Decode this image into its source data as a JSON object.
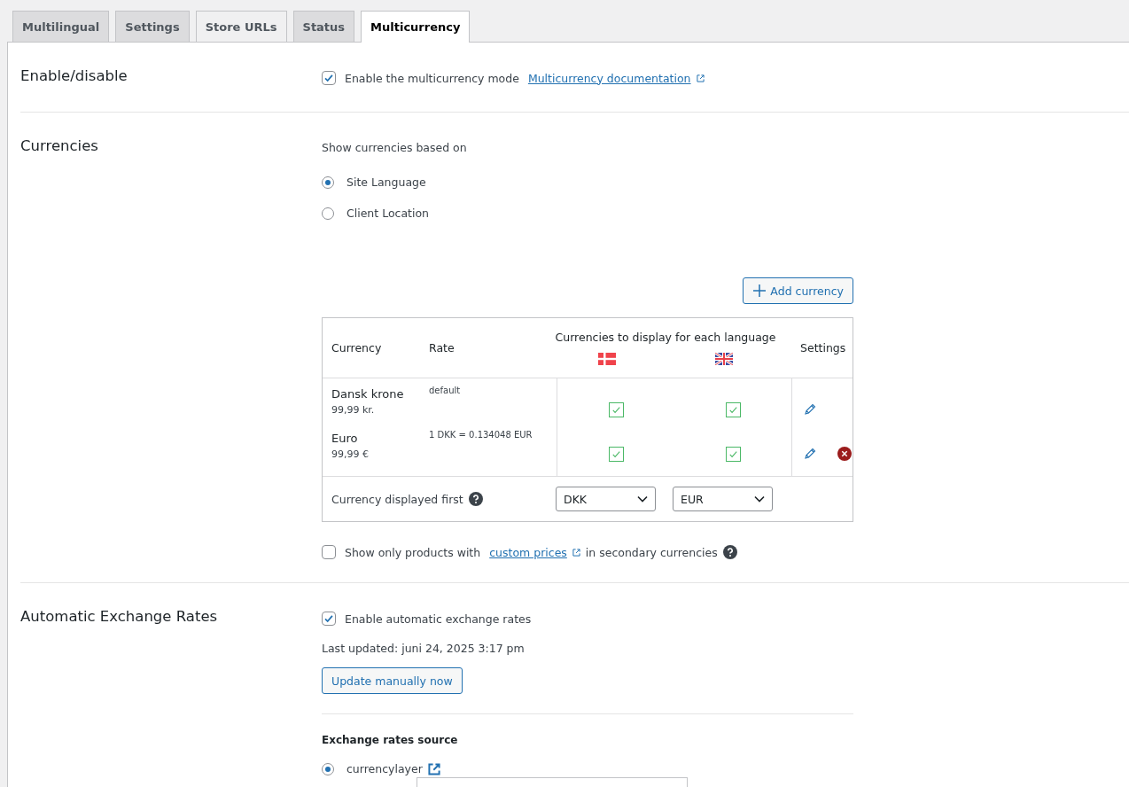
{
  "tabs": [
    {
      "label": "Multilingual",
      "selected": false
    },
    {
      "label": "Settings",
      "selected": false
    },
    {
      "label": "Store URLs",
      "selected": false
    },
    {
      "label": "Status",
      "selected": false
    },
    {
      "label": "Multicurrency",
      "selected": true
    }
  ],
  "enable_section": {
    "heading": "Enable/disable",
    "checkbox": {
      "label": "Enable the multicurrency mode",
      "checked": true
    },
    "doc_link": "Multicurrency documentation"
  },
  "currencies_section": {
    "heading": "Currencies",
    "basis_label": "Show currencies based on",
    "basis_options": [
      {
        "label": "Site Language",
        "selected": true
      },
      {
        "label": "Client Location",
        "selected": false
      }
    ],
    "add_button": "Add currency",
    "table": {
      "columns": {
        "currency": "Currency",
        "rate": "Rate",
        "languages": "Currencies to display for each language",
        "settings": "Settings"
      },
      "languages": [
        {
          "kind": "dk"
        },
        {
          "kind": "uk"
        }
      ],
      "rows": [
        {
          "name": "Dansk krone",
          "price": "99,99 kr.",
          "rate": "default",
          "display": [
            true,
            true
          ],
          "removable": false
        },
        {
          "name": "Euro",
          "price": "99,99 €",
          "rate": "1 DKK = 0.134048 EUR",
          "display": [
            true,
            true
          ],
          "removable": true
        }
      ],
      "first_label": "Currency displayed first",
      "first_values": [
        "DKK",
        "EUR"
      ]
    },
    "custom_prices": {
      "checked": false,
      "before": "Show only products with",
      "link": "custom prices",
      "after": "in secondary currencies"
    }
  },
  "rates_section": {
    "heading": "Automatic Exchange Rates",
    "checkbox": {
      "label": "Enable automatic exchange rates",
      "checked": true
    },
    "last_updated": "Last updated: juni 24, 2025 3:17 pm",
    "update_button": "Update manually now",
    "source_heading": "Exchange rates source",
    "sources": [
      {
        "label": "currencylayer",
        "selected": true
      }
    ]
  }
}
